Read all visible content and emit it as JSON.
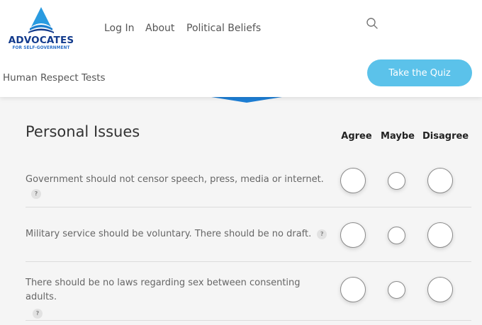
{
  "header": {
    "logo_title": "ADVOCATES",
    "logo_subtitle": "FOR SELF-GOVERNMENT",
    "nav": [
      "Log In",
      "About",
      "Political Beliefs"
    ],
    "sub_nav": "Human Respect Tests",
    "cta_label": "Take the Quiz",
    "accent_color": "#5bc2ea",
    "logo_color": "#123a8c"
  },
  "section": {
    "title": "Personal Issues",
    "columns": [
      "Agree",
      "Maybe",
      "Disagree"
    ],
    "questions": [
      {
        "text": "Government should not censor speech, press, media or internet.",
        "help": "?"
      },
      {
        "text": "Military service should be voluntary. There should be no draft.",
        "help": "?"
      },
      {
        "text": "There should be no laws regarding sex between consenting adults.",
        "help": "?"
      }
    ]
  }
}
